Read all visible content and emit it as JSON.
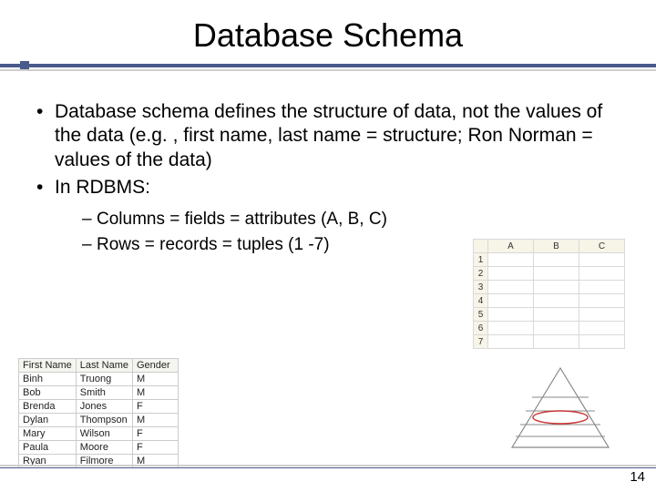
{
  "title": "Database Schema",
  "bullets": [
    "Database schema defines the structure of data, not the values of the data (e.g. , first name, last name = structure; Ron Norman = values of the data)",
    "In RDBMS:"
  ],
  "subbullets": [
    "Columns = fields = attributes (A, B, C)",
    "Rows = records = tuples (1 -7)"
  ],
  "sheet": {
    "cols": [
      "A",
      "B",
      "C"
    ],
    "rows": [
      "1",
      "2",
      "3",
      "4",
      "5",
      "6",
      "7"
    ]
  },
  "people": {
    "headers": [
      "First Name",
      "Last Name",
      "Gender"
    ],
    "rows": [
      [
        "Binh",
        "Truong",
        "M"
      ],
      [
        "Bob",
        "Smith",
        "M"
      ],
      [
        "Brenda",
        "Jones",
        "F"
      ],
      [
        "Dylan",
        "Thompson",
        "M"
      ],
      [
        "Mary",
        "Wilson",
        "F"
      ],
      [
        "Paula",
        "Moore",
        "F"
      ],
      [
        "Ryan",
        "Filmore",
        "M"
      ]
    ]
  },
  "page_number": "14"
}
